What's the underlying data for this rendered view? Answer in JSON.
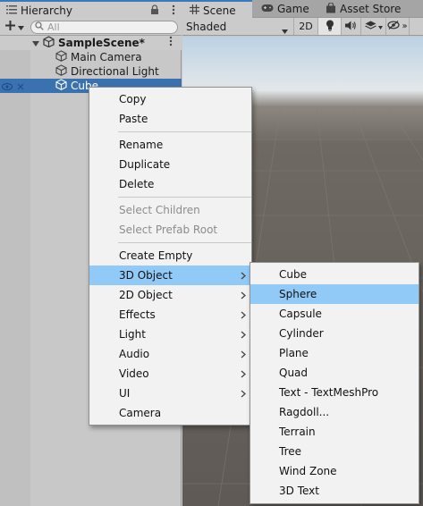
{
  "hierarchy": {
    "tab_label": "Hierarchy",
    "search_placeholder": "All",
    "scene_name": "SampleScene*",
    "objects": [
      "Main Camera",
      "Directional Light",
      "Cube"
    ]
  },
  "scene_panel": {
    "tabs": [
      "Scene",
      "Game",
      "Asset Store"
    ],
    "shading_mode": "Shaded",
    "mode_2d_label": "2D"
  },
  "context_menu": {
    "groups": [
      [
        "Copy",
        "Paste"
      ],
      [
        "Rename",
        "Duplicate",
        "Delete"
      ],
      [
        "Select Children",
        "Select Prefab Root"
      ],
      [
        "Create Empty",
        "3D Object",
        "2D Object",
        "Effects",
        "Light",
        "Audio",
        "Video",
        "UI",
        "Camera"
      ]
    ],
    "disabled": [
      "Select Children",
      "Select Prefab Root"
    ],
    "with_submenu": [
      "3D Object",
      "2D Object",
      "Effects",
      "Light",
      "Audio",
      "Video",
      "UI"
    ],
    "highlighted": "3D Object"
  },
  "submenu_3d_object": {
    "items": [
      "Cube",
      "Sphere",
      "Capsule",
      "Cylinder",
      "Plane",
      "Quad",
      "Text - TextMeshPro",
      "Ragdoll...",
      "Terrain",
      "Tree",
      "Wind Zone",
      "3D Text"
    ],
    "highlighted": "Sphere"
  },
  "colors": {
    "selection_blue": "#3a72b0",
    "menu_highlight": "#91c9f7",
    "tab_accent": "#3a79bb"
  }
}
